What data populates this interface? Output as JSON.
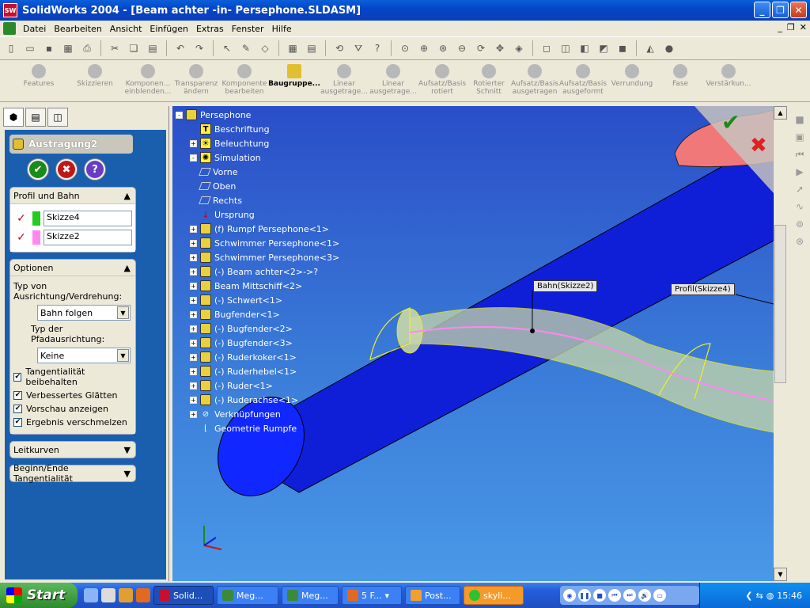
{
  "window": {
    "title": "SolidWorks 2004 - [Beam achter -in- Persephone.SLDASM]"
  },
  "menu": [
    "Datei",
    "Bearbeiten",
    "Ansicht",
    "Einfügen",
    "Extras",
    "Fenster",
    "Hilfe"
  ],
  "commands": [
    {
      "label": "Features",
      "active": false
    },
    {
      "label": "Skizzieren",
      "active": false
    },
    {
      "label": "Komponen... einblenden...",
      "active": false
    },
    {
      "label": "Transparenz ändern",
      "active": false
    },
    {
      "label": "Komponente bearbeiten",
      "active": false
    },
    {
      "label": "Baugruppe...",
      "active": true
    },
    {
      "label": "Linear ausgetrage...",
      "active": false
    },
    {
      "label": "Linear ausgetrage...",
      "active": false
    },
    {
      "label": "Aufsatz/Basis rotiert",
      "active": false
    },
    {
      "label": "Rotierter Schnitt",
      "active": false
    },
    {
      "label": "Aufsatz/Basis ausgetragen",
      "active": false
    },
    {
      "label": "Aufsatz/Basis ausgeformt",
      "active": false
    },
    {
      "label": "Verrundung",
      "active": false
    },
    {
      "label": "Fase",
      "active": false
    },
    {
      "label": "Verstärkun...",
      "active": false
    }
  ],
  "property_manager": {
    "title": "Austragung2",
    "sections": {
      "profile_path": {
        "label": "Profil und Bahn",
        "profile": "Skizze4",
        "path": "Skizze2"
      },
      "options": {
        "label": "Optionen",
        "orientation_label": "Typ von Ausrichtung/Verdrehung:",
        "orientation_value": "Bahn folgen",
        "path_alignment_label": "Typ der Pfadausrichtung:",
        "path_alignment_value": "Keine",
        "checkboxes": [
          {
            "label": "Tangentialität beibehalten",
            "checked": true
          },
          {
            "label": "Verbessertes Glätten",
            "checked": true
          },
          {
            "label": "Vorschau anzeigen",
            "checked": true
          },
          {
            "label": "Ergebnis verschmelzen",
            "checked": true
          }
        ]
      },
      "guide_curves": {
        "label": "Leitkurven"
      },
      "tangency": {
        "label": "Beginn/Ende Tangentialität"
      }
    }
  },
  "tree": [
    {
      "label": "Persephone",
      "icon": "assembly-icon",
      "expand": "-"
    },
    {
      "label": "Beschriftung",
      "icon": "annotation-icon",
      "expand": ""
    },
    {
      "label": "Beleuchtung",
      "icon": "lighting-icon",
      "expand": "+"
    },
    {
      "label": "Simulation",
      "icon": "simulation-icon",
      "expand": "-"
    },
    {
      "label": "Vorne",
      "icon": "plane-icon",
      "expand": ""
    },
    {
      "label": "Oben",
      "icon": "plane-icon",
      "expand": ""
    },
    {
      "label": "Rechts",
      "icon": "plane-icon",
      "expand": ""
    },
    {
      "label": "Ursprung",
      "icon": "origin-icon",
      "expand": ""
    },
    {
      "label": "(f) Rumpf Persephone<1>",
      "icon": "part-icon",
      "expand": "+"
    },
    {
      "label": "Schwimmer Persephone<1>",
      "icon": "part-icon",
      "expand": "+"
    },
    {
      "label": "Schwimmer Persephone<3>",
      "icon": "part-icon",
      "expand": "+"
    },
    {
      "label": "(-) Beam achter<2>->?",
      "icon": "part-icon",
      "expand": "+"
    },
    {
      "label": "Beam Mittschiff<2>",
      "icon": "part-icon",
      "expand": "+"
    },
    {
      "label": "(-) Schwert<1>",
      "icon": "part-icon",
      "expand": "+"
    },
    {
      "label": "Bugfender<1>",
      "icon": "part-icon",
      "expand": "+"
    },
    {
      "label": "(-) Bugfender<2>",
      "icon": "part-icon",
      "expand": "+"
    },
    {
      "label": "(-) Bugfender<3>",
      "icon": "part-icon",
      "expand": "+"
    },
    {
      "label": "(-) Ruderkoker<1>",
      "icon": "part-icon",
      "expand": "+"
    },
    {
      "label": "(-) Ruderhebel<1>",
      "icon": "part-icon",
      "expand": "+"
    },
    {
      "label": "(-) Ruder<1>",
      "icon": "part-icon",
      "expand": "+"
    },
    {
      "label": "(-) Ruderachse<1>",
      "icon": "part-icon",
      "expand": "+"
    },
    {
      "label": "Verknüpfungen",
      "icon": "mates-icon",
      "expand": "+"
    },
    {
      "label": "Geometrie Rumpfe",
      "icon": "sketch-icon",
      "expand": ""
    }
  ],
  "callouts": {
    "path": "Bahn(Skizze2)",
    "profile": "Profil(Skizze4)"
  },
  "taskbar": {
    "start": "Start",
    "tasks": [
      {
        "label": "Solid...",
        "active": true,
        "color": "#c8102e"
      },
      {
        "label": "Meg...",
        "active": false,
        "color": "#3a8a3a"
      },
      {
        "label": "Meg...",
        "active": false,
        "color": "#3a8a3a"
      },
      {
        "label": "5 F...",
        "active": false,
        "color": "#e06a20"
      },
      {
        "label": "Post...",
        "active": false,
        "color": "#f0a030"
      },
      {
        "label": "skyli...",
        "active": false,
        "color": "#30c030",
        "orange": true
      }
    ],
    "clock": "15:46"
  },
  "colors": {
    "titlebar": "#0a5fd8",
    "propertymanager": "#1a5fae",
    "viewport_top": "#2a4ec8",
    "beam": "#0f1fd8",
    "sweep_preview": "#c8d8a8",
    "profile_sketch": "#22cc22",
    "path_sketch": "#ff88ee"
  }
}
